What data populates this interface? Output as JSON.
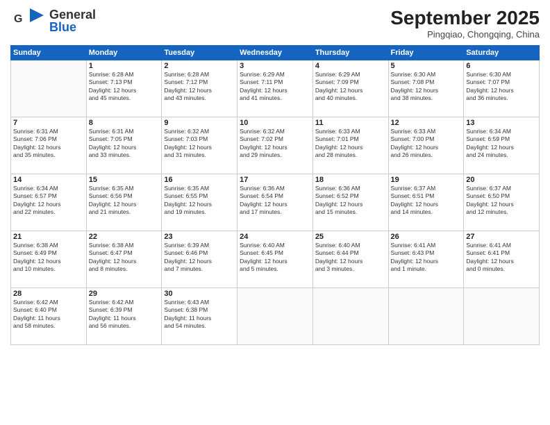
{
  "header": {
    "logo_general": "General",
    "logo_blue": "Blue",
    "month_year": "September 2025",
    "location": "Pingqiao, Chongqing, China"
  },
  "weekdays": [
    "Sunday",
    "Monday",
    "Tuesday",
    "Wednesday",
    "Thursday",
    "Friday",
    "Saturday"
  ],
  "weeks": [
    [
      {
        "day": "",
        "info": ""
      },
      {
        "day": "1",
        "info": "Sunrise: 6:28 AM\nSunset: 7:13 PM\nDaylight: 12 hours\nand 45 minutes."
      },
      {
        "day": "2",
        "info": "Sunrise: 6:28 AM\nSunset: 7:12 PM\nDaylight: 12 hours\nand 43 minutes."
      },
      {
        "day": "3",
        "info": "Sunrise: 6:29 AM\nSunset: 7:11 PM\nDaylight: 12 hours\nand 41 minutes."
      },
      {
        "day": "4",
        "info": "Sunrise: 6:29 AM\nSunset: 7:09 PM\nDaylight: 12 hours\nand 40 minutes."
      },
      {
        "day": "5",
        "info": "Sunrise: 6:30 AM\nSunset: 7:08 PM\nDaylight: 12 hours\nand 38 minutes."
      },
      {
        "day": "6",
        "info": "Sunrise: 6:30 AM\nSunset: 7:07 PM\nDaylight: 12 hours\nand 36 minutes."
      }
    ],
    [
      {
        "day": "7",
        "info": "Sunrise: 6:31 AM\nSunset: 7:06 PM\nDaylight: 12 hours\nand 35 minutes."
      },
      {
        "day": "8",
        "info": "Sunrise: 6:31 AM\nSunset: 7:05 PM\nDaylight: 12 hours\nand 33 minutes."
      },
      {
        "day": "9",
        "info": "Sunrise: 6:32 AM\nSunset: 7:03 PM\nDaylight: 12 hours\nand 31 minutes."
      },
      {
        "day": "10",
        "info": "Sunrise: 6:32 AM\nSunset: 7:02 PM\nDaylight: 12 hours\nand 29 minutes."
      },
      {
        "day": "11",
        "info": "Sunrise: 6:33 AM\nSunset: 7:01 PM\nDaylight: 12 hours\nand 28 minutes."
      },
      {
        "day": "12",
        "info": "Sunrise: 6:33 AM\nSunset: 7:00 PM\nDaylight: 12 hours\nand 26 minutes."
      },
      {
        "day": "13",
        "info": "Sunrise: 6:34 AM\nSunset: 6:59 PM\nDaylight: 12 hours\nand 24 minutes."
      }
    ],
    [
      {
        "day": "14",
        "info": "Sunrise: 6:34 AM\nSunset: 6:57 PM\nDaylight: 12 hours\nand 22 minutes."
      },
      {
        "day": "15",
        "info": "Sunrise: 6:35 AM\nSunset: 6:56 PM\nDaylight: 12 hours\nand 21 minutes."
      },
      {
        "day": "16",
        "info": "Sunrise: 6:35 AM\nSunset: 6:55 PM\nDaylight: 12 hours\nand 19 minutes."
      },
      {
        "day": "17",
        "info": "Sunrise: 6:36 AM\nSunset: 6:54 PM\nDaylight: 12 hours\nand 17 minutes."
      },
      {
        "day": "18",
        "info": "Sunrise: 6:36 AM\nSunset: 6:52 PM\nDaylight: 12 hours\nand 15 minutes."
      },
      {
        "day": "19",
        "info": "Sunrise: 6:37 AM\nSunset: 6:51 PM\nDaylight: 12 hours\nand 14 minutes."
      },
      {
        "day": "20",
        "info": "Sunrise: 6:37 AM\nSunset: 6:50 PM\nDaylight: 12 hours\nand 12 minutes."
      }
    ],
    [
      {
        "day": "21",
        "info": "Sunrise: 6:38 AM\nSunset: 6:49 PM\nDaylight: 12 hours\nand 10 minutes."
      },
      {
        "day": "22",
        "info": "Sunrise: 6:38 AM\nSunset: 6:47 PM\nDaylight: 12 hours\nand 8 minutes."
      },
      {
        "day": "23",
        "info": "Sunrise: 6:39 AM\nSunset: 6:46 PM\nDaylight: 12 hours\nand 7 minutes."
      },
      {
        "day": "24",
        "info": "Sunrise: 6:40 AM\nSunset: 6:45 PM\nDaylight: 12 hours\nand 5 minutes."
      },
      {
        "day": "25",
        "info": "Sunrise: 6:40 AM\nSunset: 6:44 PM\nDaylight: 12 hours\nand 3 minutes."
      },
      {
        "day": "26",
        "info": "Sunrise: 6:41 AM\nSunset: 6:43 PM\nDaylight: 12 hours\nand 1 minute."
      },
      {
        "day": "27",
        "info": "Sunrise: 6:41 AM\nSunset: 6:41 PM\nDaylight: 12 hours\nand 0 minutes."
      }
    ],
    [
      {
        "day": "28",
        "info": "Sunrise: 6:42 AM\nSunset: 6:40 PM\nDaylight: 11 hours\nand 58 minutes."
      },
      {
        "day": "29",
        "info": "Sunrise: 6:42 AM\nSunset: 6:39 PM\nDaylight: 11 hours\nand 56 minutes."
      },
      {
        "day": "30",
        "info": "Sunrise: 6:43 AM\nSunset: 6:38 PM\nDaylight: 11 hours\nand 54 minutes."
      },
      {
        "day": "",
        "info": ""
      },
      {
        "day": "",
        "info": ""
      },
      {
        "day": "",
        "info": ""
      },
      {
        "day": "",
        "info": ""
      }
    ]
  ]
}
